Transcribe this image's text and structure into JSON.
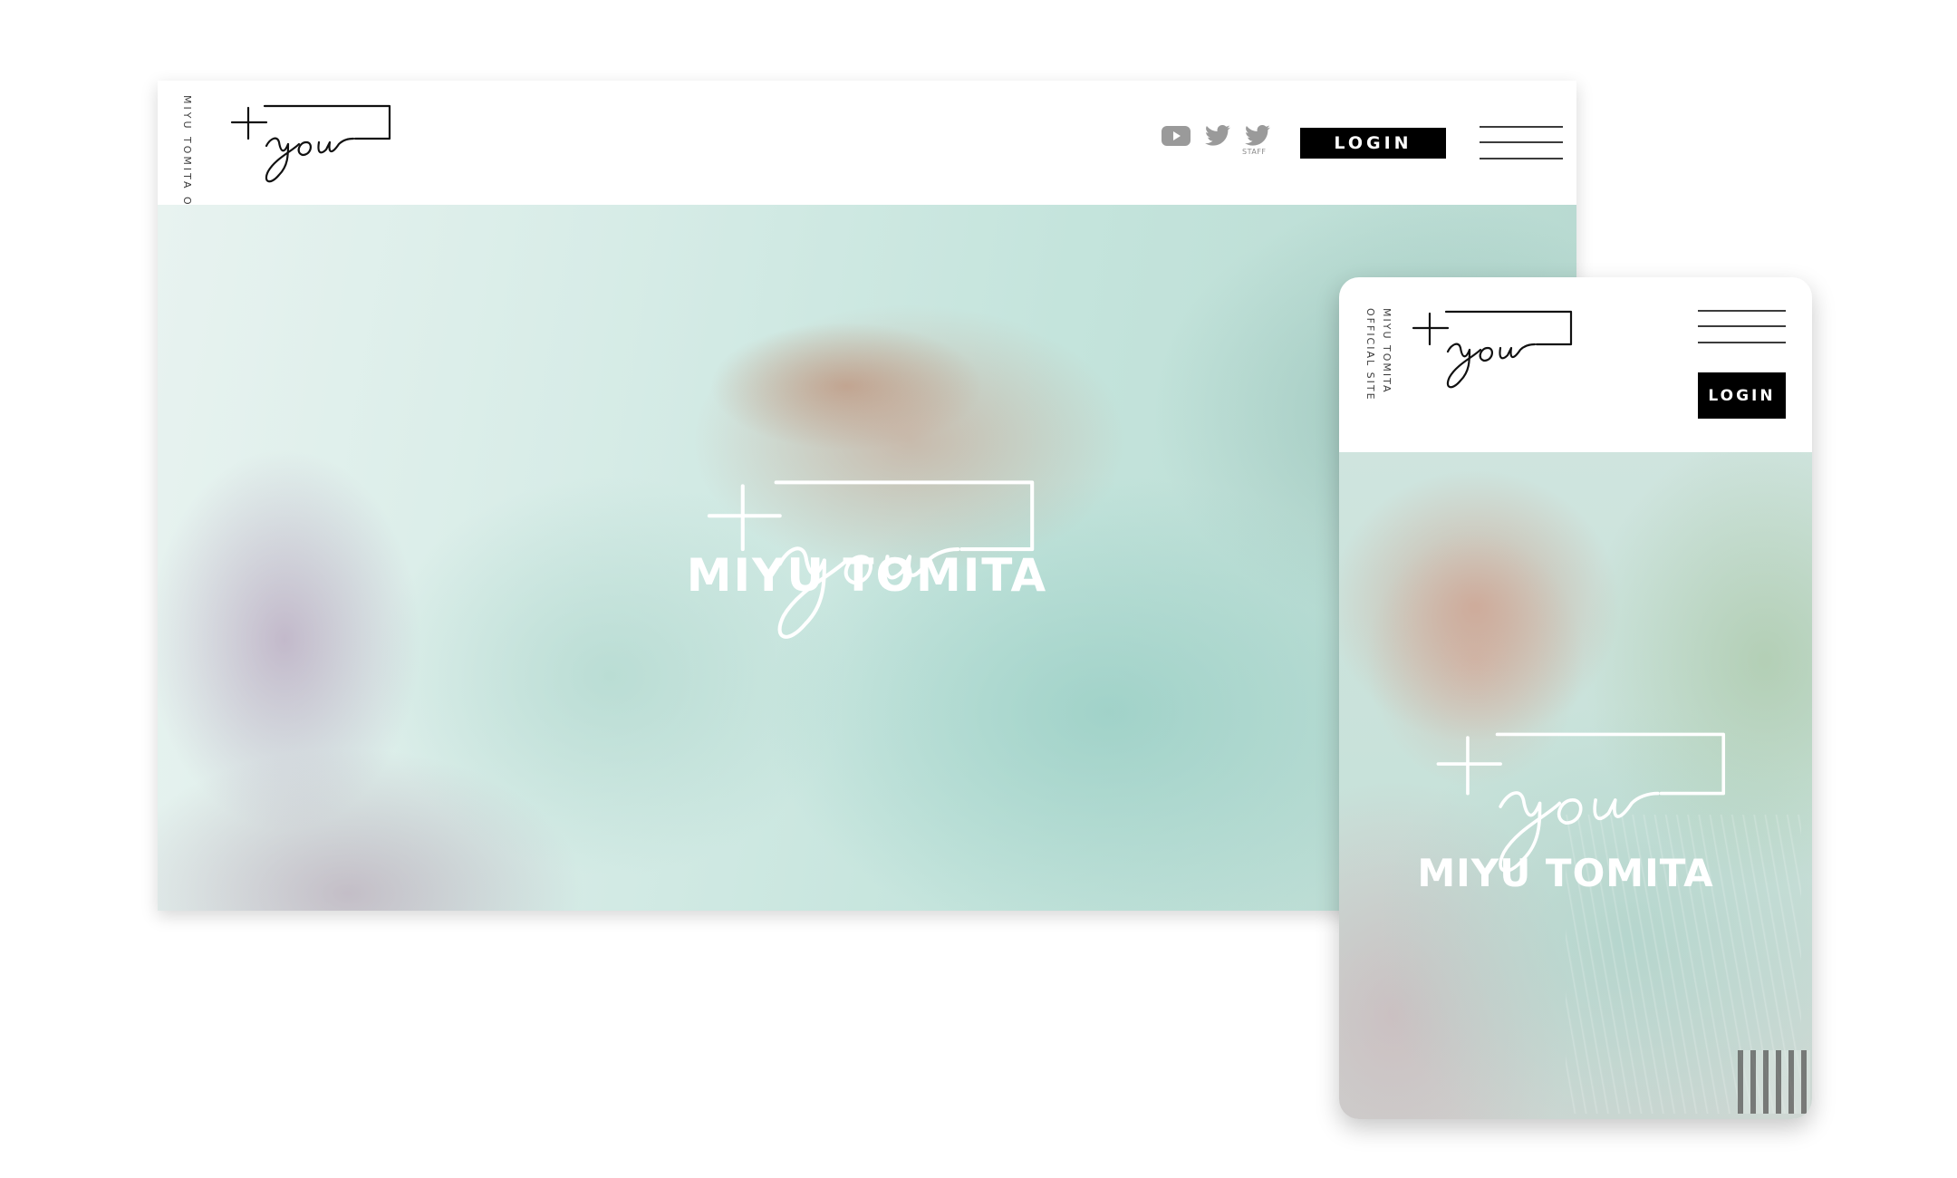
{
  "brand": {
    "logo_text": "+you",
    "site_vertical_label": "MIYU TOMITA OFFICIAL SITE",
    "mobile_vertical_label_line1": "MIYU TOMITA",
    "mobile_vertical_label_line2": "OFFICIAL SITE"
  },
  "header": {
    "social": [
      {
        "icon": "youtube-icon"
      },
      {
        "icon": "twitter-icon"
      },
      {
        "icon": "twitter-icon",
        "label": "STAFF"
      }
    ],
    "login_label": "LOGIN",
    "menu_icon": "hamburger-menu-icon"
  },
  "hero": {
    "title": "MIYU TOMITA",
    "logo_text": "+you"
  },
  "colors": {
    "text_dark": "#3a3a3a",
    "button_bg": "#000000",
    "button_text": "#ffffff",
    "hero_mint": "#c4e4dc"
  }
}
